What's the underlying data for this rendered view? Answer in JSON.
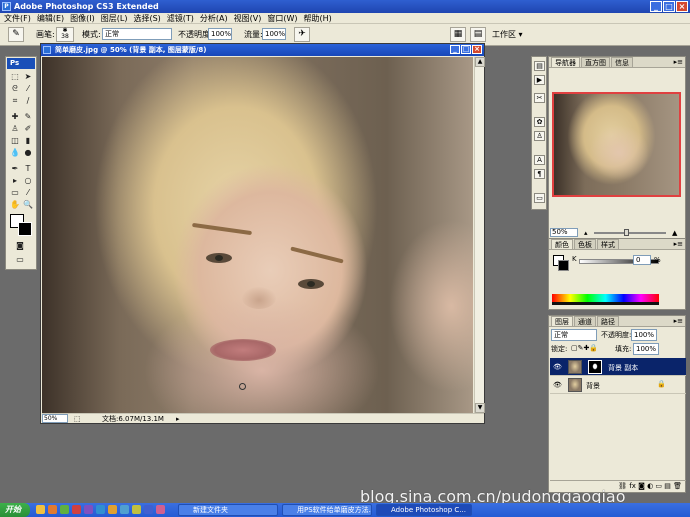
{
  "app": {
    "title": "Adobe Photoshop CS3 Extended"
  },
  "menu": [
    "文件(F)",
    "编辑(E)",
    "图像(I)",
    "图层(L)",
    "选择(S)",
    "滤镜(T)",
    "分析(A)",
    "视图(V)",
    "窗口(W)",
    "帮助(H)"
  ],
  "options": {
    "brush_label": "画笔:",
    "brush_size": "38",
    "mode_label": "模式:",
    "mode_value": "正常",
    "opacity_label": "不透明度:",
    "opacity_value": "100%",
    "flow_label": "流量:",
    "flow_value": "100%",
    "workspace": "工作区 ▾"
  },
  "document": {
    "title": "简单磨皮.jpg @ 50% (背景 副本, 图层蒙版/8)",
    "zoom": "50%",
    "info": "文档:6.07M/13.1M"
  },
  "navigator": {
    "tabs": [
      "导航器",
      "直方图",
      "信息"
    ],
    "zoom": "50%"
  },
  "color_panel": {
    "tabs": [
      "颜色",
      "色板",
      "样式"
    ],
    "channel_label": "K",
    "k_value": "0",
    "unit": "%"
  },
  "layers_panel": {
    "tabs": [
      "图层",
      "通道",
      "路径"
    ],
    "blend_mode": "正常",
    "opacity_label": "不透明度:",
    "opacity_value": "100%",
    "lock_label": "锁定:",
    "fill_label": "填充:",
    "fill_value": "100%",
    "layers": [
      {
        "name": "背景 副本",
        "selected": true
      },
      {
        "name": "背景",
        "selected": false
      }
    ]
  },
  "taskbar": {
    "start": "开始",
    "tasks": [
      "新建文件夹",
      "用PS软件给单磨皮方法...",
      "Adobe Photoshop C..."
    ],
    "watermark": "blog.sina.com.cn/pudonggaoqiao"
  }
}
